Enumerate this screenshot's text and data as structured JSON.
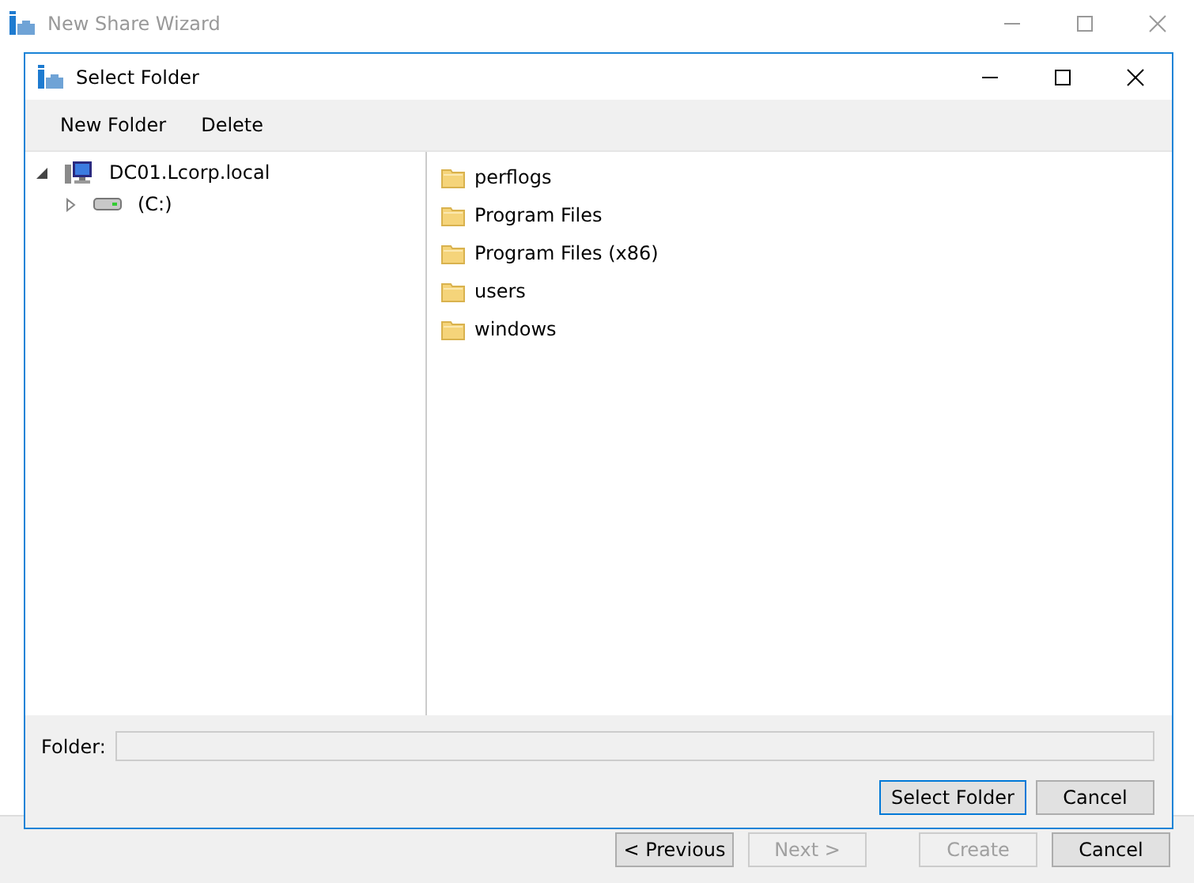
{
  "wizard": {
    "title": "New Share Wizard",
    "buttons": [
      {
        "label": "< Previous",
        "disabled": false
      },
      {
        "label": "Next >",
        "disabled": true
      },
      {
        "label": "Create",
        "disabled": true
      },
      {
        "label": "Cancel",
        "disabled": false
      }
    ]
  },
  "dialog": {
    "title": "Select Folder",
    "toolbar": [
      "New Folder",
      "Delete"
    ],
    "tree": [
      {
        "label": "DC01.Lcorp.local",
        "kind": "computer",
        "expanded": true,
        "children": [
          {
            "label": "(C:)",
            "kind": "drive",
            "expanded": false
          }
        ]
      }
    ],
    "folders": [
      "perflogs",
      "Program Files",
      "Program Files (x86)",
      "users",
      "windows"
    ],
    "folder_field": {
      "label": "Folder:"
    },
    "buttons": [
      {
        "label": "Select Folder",
        "default": true
      },
      {
        "label": "Cancel",
        "default": false
      }
    ]
  }
}
